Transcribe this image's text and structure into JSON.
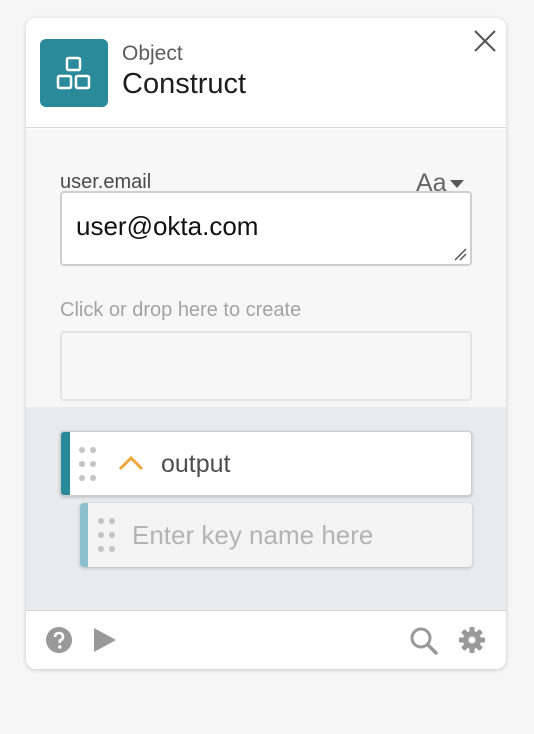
{
  "header": {
    "subtitle": "Object",
    "title": "Construct",
    "app_icon": "object-construct-icon",
    "close_icon": "close-icon"
  },
  "field": {
    "label": "user.email",
    "type_toggle": "Aa",
    "value": "user@okta.com"
  },
  "drop_zone": {
    "hint": "Click or drop here to create"
  },
  "outputs": {
    "label": "output",
    "key_placeholder": "Enter key name here"
  },
  "footer": {
    "icons": [
      "help-icon",
      "play-icon",
      "search-icon",
      "gear-icon"
    ]
  },
  "colors": {
    "accent": "#2a8a9a",
    "accent_light": "#8cc0cc",
    "chevron": "#f0a63a"
  }
}
